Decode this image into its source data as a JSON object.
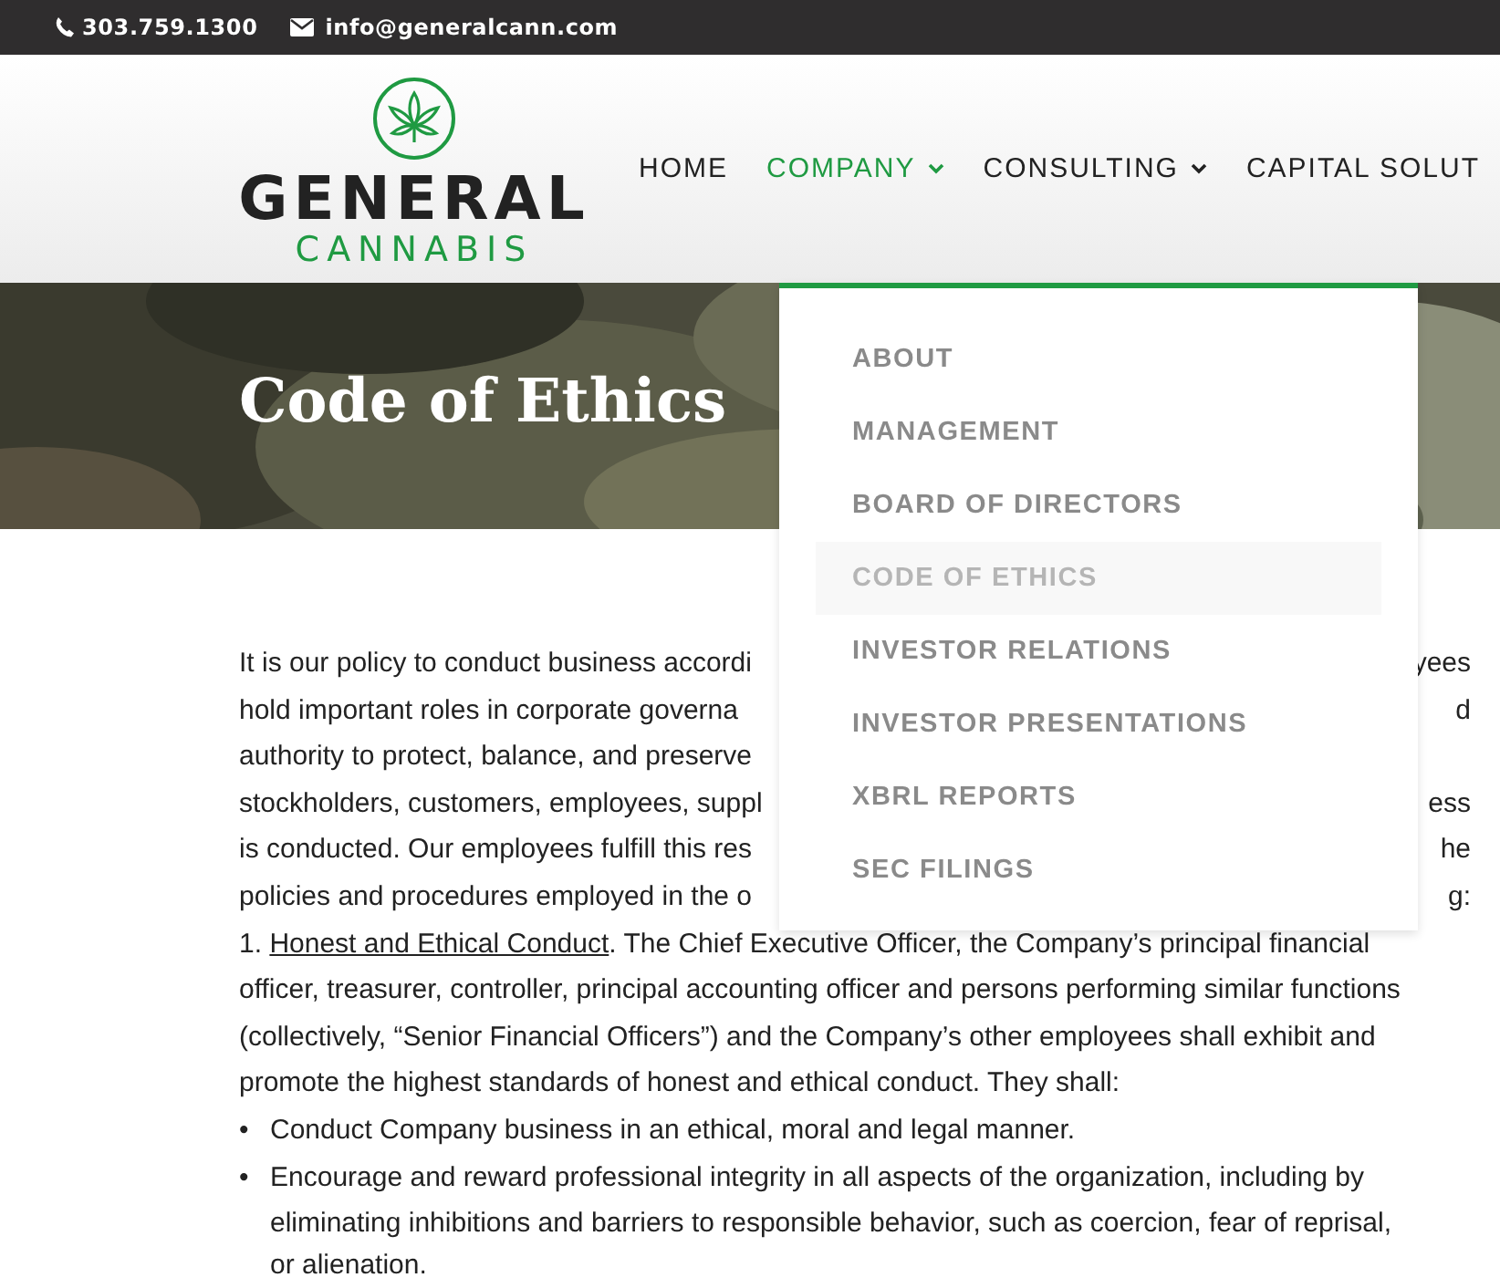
{
  "top_bar": {
    "phone": "303.759.1300",
    "email": "info@generalcann.com"
  },
  "logo": {
    "line1": "GENERAL",
    "line2": "CANNABIS"
  },
  "nav": [
    {
      "label": "HOME",
      "selected": false,
      "has_submenu": false
    },
    {
      "label": "COMPANY",
      "selected": true,
      "has_submenu": true
    },
    {
      "label": "CONSULTING",
      "selected": false,
      "has_submenu": true
    },
    {
      "label": "CAPITAL SOLUT",
      "selected": false,
      "has_submenu": false
    }
  ],
  "hero": {
    "kind": "picture",
    "title": "Code of Ethics"
  },
  "dropdown": [
    {
      "label": "ABOUT",
      "selected": false
    },
    {
      "label": "MANAGEMENT",
      "selected": false
    },
    {
      "label": "BOARD OF DIRECTORS",
      "selected": false
    },
    {
      "label": "CODE OF ETHICS",
      "selected": true
    },
    {
      "label": "INVESTOR RELATIONS",
      "selected": false
    },
    {
      "label": "INVESTOR PRESENTATIONS",
      "selected": false
    },
    {
      "label": "XBRL REPORTS",
      "selected": false
    },
    {
      "label": "SEC FILINGS",
      "selected": false
    }
  ],
  "content": {
    "lines": [
      {
        "kind": "split",
        "left": "It is our policy to conduct business accordi",
        "right": "yees"
      },
      {
        "kind": "split",
        "left": "hold important roles in corporate governa",
        "right": "d"
      },
      {
        "kind": "split",
        "left": "authority to protect, balance, and preserve"
      },
      {
        "kind": "split",
        "left": "stockholders, customers, employees, suppl",
        "right": "ess"
      },
      {
        "kind": "split",
        "left": "is conducted. Our employees fulfill this res",
        "right": "he"
      },
      {
        "kind": "split",
        "left": "policies and procedures employed in the o",
        "right": "g:"
      },
      {
        "kind": "link",
        "before": "1. ",
        "link": "Honest and Ethical Conduct",
        "after": ". The Chief Executive Officer, the Company’s principal financial"
      },
      {
        "kind": "plain",
        "text": "officer, treasurer, controller, principal accounting officer and persons performing similar functions"
      },
      {
        "kind": "plain",
        "text": "(collectively, “Senior Financial Officers”) and the Company’s other employees shall exhibit and"
      },
      {
        "kind": "plain",
        "text": "promote the highest standards of honest and ethical conduct. They shall:"
      }
    ],
    "bullets": [
      {
        "marker": "•",
        "lines": [
          "Conduct Company business in an ethical, moral and legal manner."
        ]
      },
      {
        "marker": "•",
        "lines": [
          "Encourage and reward professional integrity in all aspects of the organization, including by",
          "eliminating inhibitions and barriers to responsible behavior, such as coercion, fear of reprisal,",
          "or alienation."
        ]
      }
    ]
  }
}
